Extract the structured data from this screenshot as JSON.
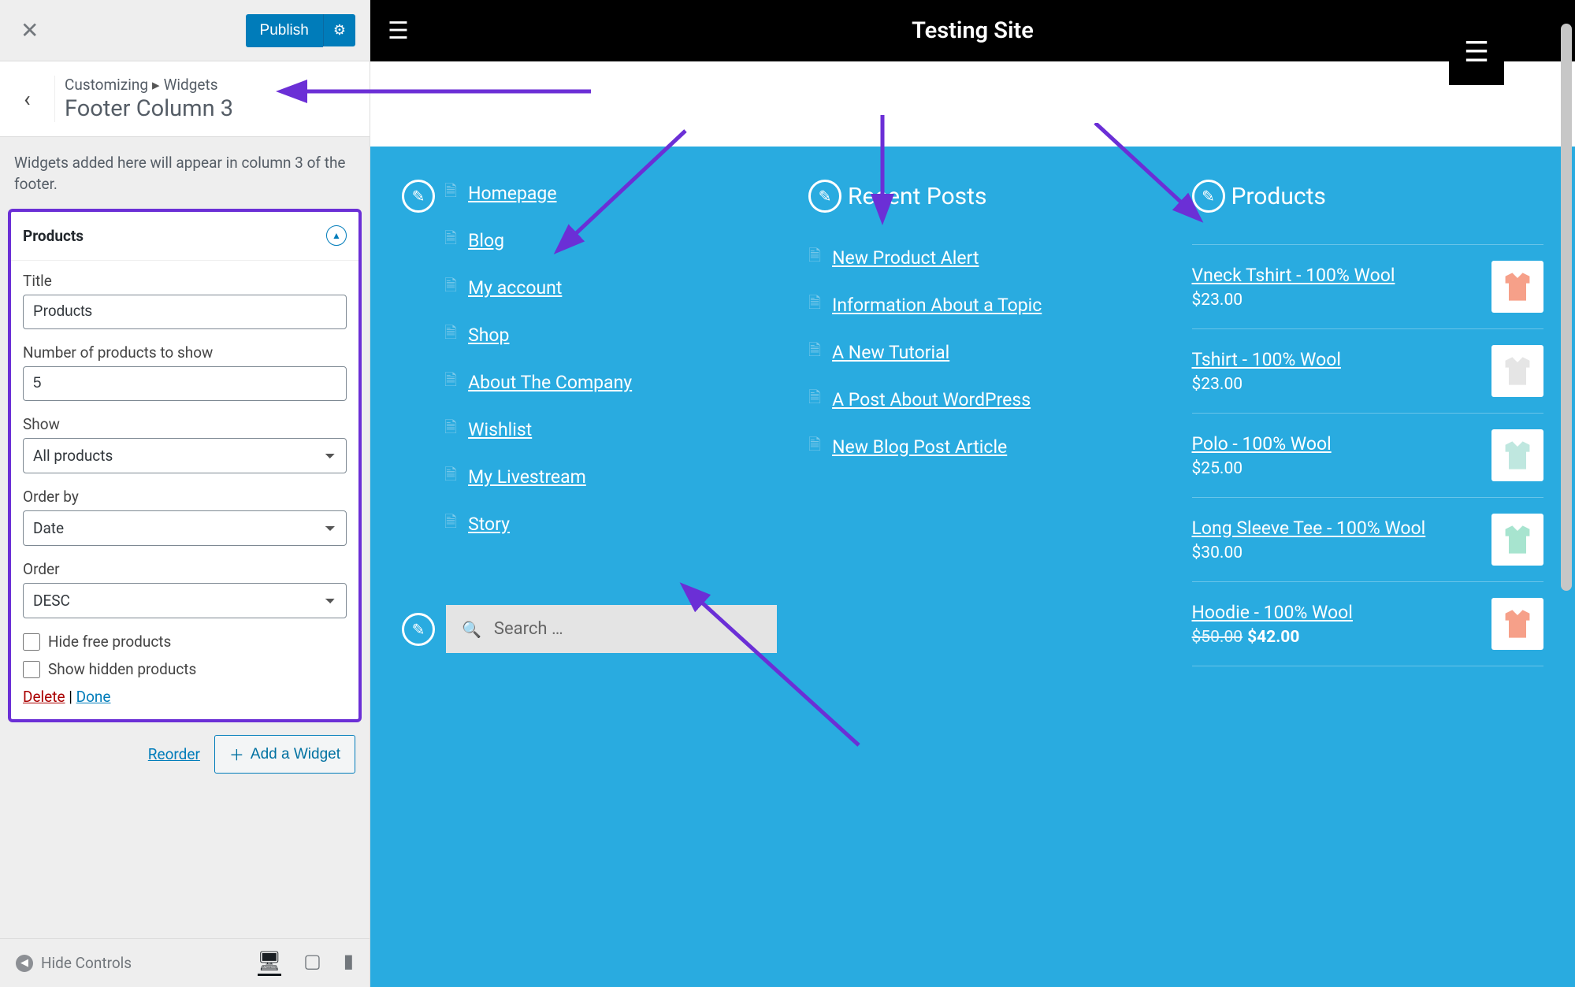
{
  "sidebar": {
    "publish_label": "Publish",
    "breadcrumb_root": "Customizing",
    "breadcrumb_leaf": "Widgets",
    "section_title": "Footer Column 3",
    "description": "Widgets added here will appear in column 3 of the footer.",
    "widget": {
      "header": "Products",
      "title_label": "Title",
      "title_value": "Products",
      "num_label": "Number of products to show",
      "num_value": "5",
      "show_label": "Show",
      "show_value": "All products",
      "orderby_label": "Order by",
      "orderby_value": "Date",
      "order_label": "Order",
      "order_value": "DESC",
      "hide_free_label": "Hide free products",
      "show_hidden_label": "Show hidden products",
      "delete_label": "Delete",
      "done_label": "Done"
    },
    "reorder_label": "Reorder",
    "add_widget_label": "Add a Widget",
    "hide_controls_label": "Hide Controls"
  },
  "preview": {
    "site_title": "Testing Site",
    "col1": {
      "items": [
        "Homepage",
        "Blog",
        "My account",
        "Shop",
        "About The Company",
        "Wishlist",
        "My Livestream",
        "Story"
      ]
    },
    "col2": {
      "title": "Recent Posts",
      "items": [
        "New Product Alert",
        "Information About a Topic",
        "A New Tutorial",
        "A Post About WordPress",
        "New Blog Post Article"
      ]
    },
    "col3": {
      "title": "Products",
      "items": [
        {
          "name": "Vneck Tshirt - 100% Wool",
          "price": "$23.00",
          "color": "#f6a089"
        },
        {
          "name": "Tshirt - 100% Wool",
          "price": "$23.00",
          "color": "#e5e5e5"
        },
        {
          "name": "Polo - 100% Wool",
          "price": "$25.00",
          "color": "#bfe7df"
        },
        {
          "name": "Long Sleeve Tee - 100% Wool",
          "price": "$30.00",
          "color": "#a7e4cf"
        },
        {
          "name": "Hoodie - 100% Wool",
          "price": "$42.00",
          "old": "$50.00",
          "color": "#f6a089"
        }
      ]
    },
    "search_placeholder": "Search …"
  }
}
